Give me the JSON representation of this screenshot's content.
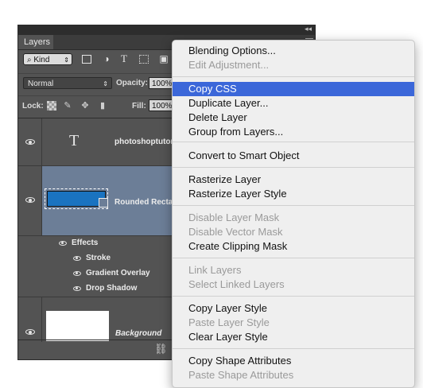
{
  "panel": {
    "tab_label": "Layers",
    "collapse_glyph": "◂◂",
    "filter": {
      "kind_label": "Kind",
      "icons": [
        "image-filter-icon",
        "adjustment-filter-icon",
        "type-filter-icon",
        "shape-filter-icon",
        "smart-object-filter-icon"
      ]
    },
    "blend_mode": "Normal",
    "opacity_label": "Opacity:",
    "opacity_value": "100%",
    "lock_label": "Lock:",
    "fill_label": "Fill:",
    "fill_value": "100%"
  },
  "layers": [
    {
      "name": "photoshoptutori",
      "type": "text",
      "thumb_glyph": "T"
    },
    {
      "name": "Rounded Rectan",
      "type": "shape",
      "selected": true,
      "thumb_color": "#1a73c0"
    },
    {
      "name": "Background",
      "type": "background"
    }
  ],
  "effects": {
    "header": "Effects",
    "items": [
      "Stroke",
      "Gradient Overlay",
      "Drop Shadow"
    ]
  },
  "menu": {
    "items": [
      {
        "label": "Blending Options...",
        "state": "enabled"
      },
      {
        "label": "Edit Adjustment...",
        "state": "disabled"
      },
      {
        "label": "Copy CSS",
        "state": "active"
      },
      {
        "label": "Duplicate Layer...",
        "state": "enabled"
      },
      {
        "label": "Delete Layer",
        "state": "enabled"
      },
      {
        "label": "Group from Layers...",
        "state": "enabled"
      },
      {
        "label": "Convert to Smart Object",
        "state": "enabled"
      },
      {
        "label": "Rasterize Layer",
        "state": "enabled"
      },
      {
        "label": "Rasterize Layer Style",
        "state": "enabled"
      },
      {
        "label": "Disable Layer Mask",
        "state": "disabled"
      },
      {
        "label": "Disable Vector Mask",
        "state": "disabled"
      },
      {
        "label": "Create Clipping Mask",
        "state": "enabled"
      },
      {
        "label": "Link Layers",
        "state": "disabled"
      },
      {
        "label": "Select Linked Layers",
        "state": "disabled"
      },
      {
        "label": "Copy Layer Style",
        "state": "enabled"
      },
      {
        "label": "Paste Layer Style",
        "state": "disabled"
      },
      {
        "label": "Clear Layer Style",
        "state": "enabled"
      },
      {
        "label": "Copy Shape Attributes",
        "state": "enabled"
      },
      {
        "label": "Paste Shape Attributes",
        "state": "disabled"
      }
    ],
    "highlight_color": "#3b67d9"
  }
}
